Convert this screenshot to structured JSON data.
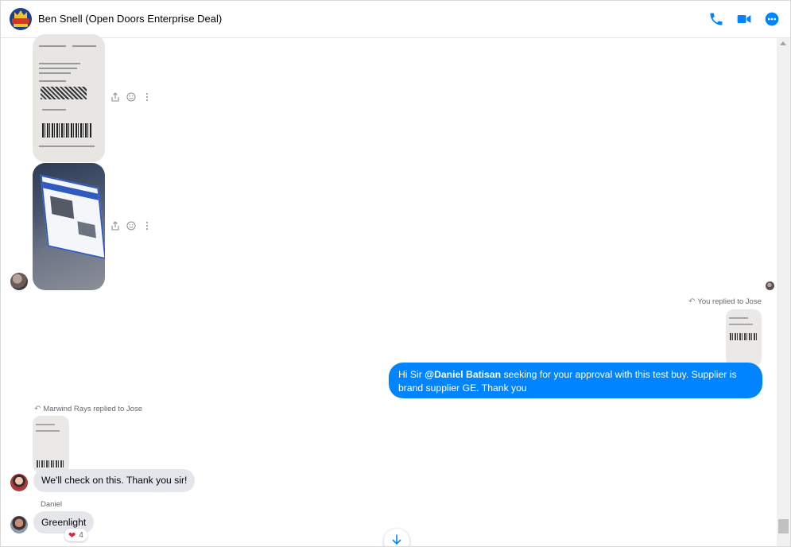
{
  "header": {
    "title": "Ben Snell (Open Doors Enterprise Deal)",
    "icons": [
      "phone-icon",
      "video-camera-icon",
      "more-icon"
    ],
    "accent_color": "#0084ff"
  },
  "messages": {
    "you_replied_note": "You replied to Jose",
    "outgoing": {
      "prefix": "Hi Sir ",
      "mention": "@Daniel Batisan",
      "suffix": " seeking for your approval with this test buy. Supplier is brand supplier GE. Thank you"
    },
    "marwind_replied_note": "Marwind Rays replied to Jose",
    "marwind_message": "We'll check on this. Thank you sir!",
    "daniel_name": "Daniel",
    "daniel_message": "Greenlight",
    "reaction_count": "4"
  },
  "colors": {
    "outgoing_bubble": "#0084ff",
    "incoming_bubble": "#e4e6eb",
    "reaction_heart": "#e41e3f"
  }
}
